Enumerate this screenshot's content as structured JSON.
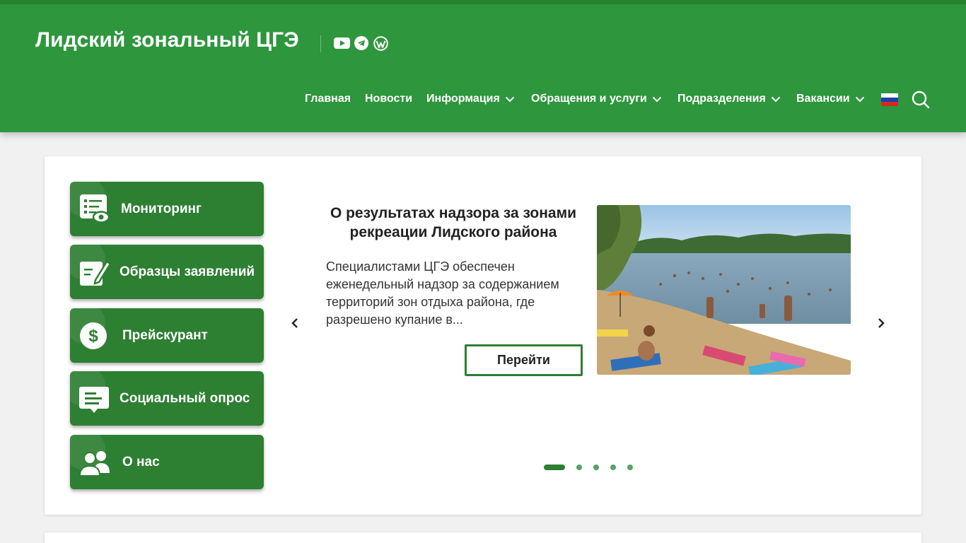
{
  "header": {
    "site_title": "Лидский зональный ЦГЭ",
    "social_icons": [
      "youtube-icon",
      "telegram-icon",
      "wordpress-icon"
    ],
    "nav": [
      {
        "label": "Главная",
        "dropdown": false
      },
      {
        "label": "Новости",
        "dropdown": false
      },
      {
        "label": "Информация",
        "dropdown": true
      },
      {
        "label": "Обращения и услуги",
        "dropdown": true
      },
      {
        "label": "Подразделения",
        "dropdown": true
      },
      {
        "label": "Вакансии",
        "dropdown": true
      }
    ],
    "language_flag": "russian-flag-icon",
    "search_icon": "search-icon"
  },
  "sidebar": {
    "items": [
      {
        "label": "Мониторинг",
        "icon": "monitoring-list-icon"
      },
      {
        "label": "Образцы заявлений",
        "icon": "edit-document-icon"
      },
      {
        "label": "Прейскурант",
        "icon": "dollar-icon"
      },
      {
        "label": "Социальный опрос",
        "icon": "survey-icon"
      },
      {
        "label": "О нас",
        "icon": "users-icon"
      }
    ]
  },
  "slider": {
    "title": "О результатах надзора за зонами рекреации Лидского района",
    "excerpt": "Специалистами ЦГЭ обеспечен еженедельный надзор за содержанием территорий зон отдыха района, где разрешено купание в...",
    "button_label": "Перейти",
    "image": "beach-photo",
    "slide_count": 5,
    "active_slide": 1
  },
  "colors": {
    "header_bg": "#2e963d",
    "button_green": "#2d7f32",
    "page_bg": "#f1f1f1"
  }
}
